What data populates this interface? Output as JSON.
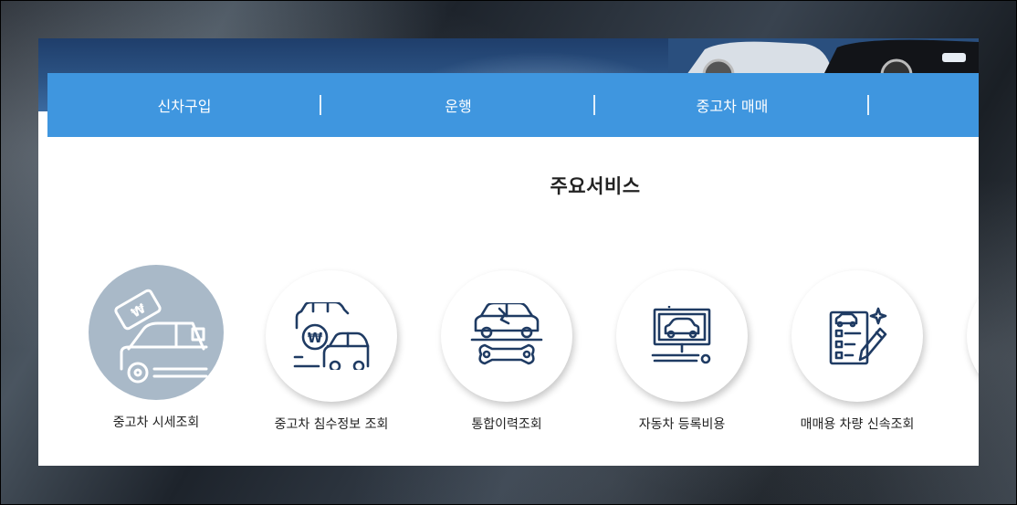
{
  "nav": {
    "items": [
      {
        "label": "신차구입"
      },
      {
        "label": "운행"
      },
      {
        "label": "중고차 매매"
      },
      {
        "label": ""
      }
    ]
  },
  "main": {
    "title": "주요서비스",
    "services": [
      {
        "label": "중고차 시세조회",
        "icon": "car-price-icon",
        "active": true
      },
      {
        "label": "중고차 침수정보 조회",
        "icon": "flood-car-icon",
        "active": false
      },
      {
        "label": "통합이력조회",
        "icon": "car-repair-history-icon",
        "active": false
      },
      {
        "label": "자동차 등록비용",
        "icon": "registration-monitor-icon",
        "active": false
      },
      {
        "label": "매매용 차량 신속조회",
        "icon": "checklist-pen-icon",
        "active": false
      }
    ]
  },
  "colors": {
    "nav_bg": "#3f96df",
    "icon_stroke": "#1f3b63",
    "active_circle": "#a9b9c8"
  }
}
